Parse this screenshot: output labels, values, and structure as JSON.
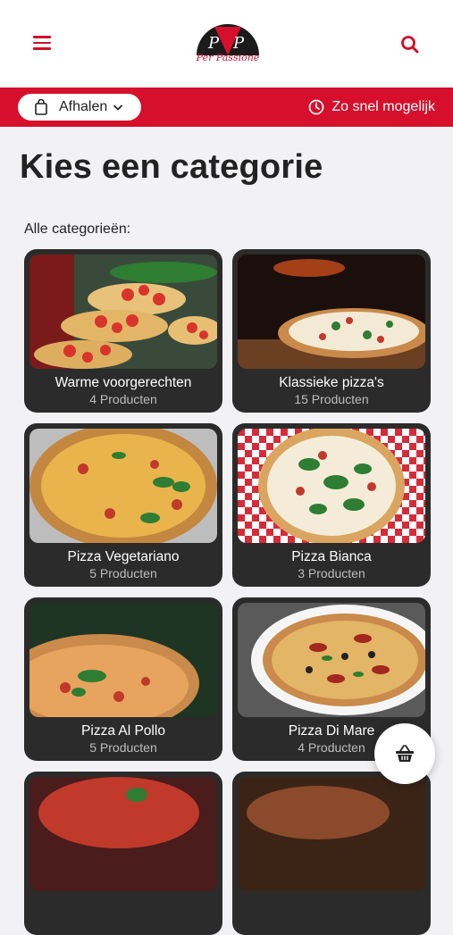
{
  "brand": {
    "logo_text": "Per Passione"
  },
  "header": {
    "menu_icon": "hamburger-menu-icon",
    "search_icon": "search-icon"
  },
  "order_bar": {
    "mode_label": "Afhalen",
    "time_label": "Zo snel mogelijk"
  },
  "page": {
    "title": "Kies een categorie",
    "subtitle": "Alle categorieën:"
  },
  "categories": [
    {
      "name": "Warme voorgerechten",
      "count": "4 Producten"
    },
    {
      "name": "Klassieke pizza's",
      "count": "15 Producten"
    },
    {
      "name": "Pizza Vegetariano",
      "count": "5 Producten"
    },
    {
      "name": "Pizza Bianca",
      "count": "3 Producten"
    },
    {
      "name": "Pizza Al Pollo",
      "count": "5 Producten"
    },
    {
      "name": "Pizza Di Mare",
      "count": "4 Producten"
    },
    {
      "name": "",
      "count": ""
    },
    {
      "name": "",
      "count": ""
    }
  ],
  "colors": {
    "brand_red": "#d6102c",
    "card_bg": "#2b2b2b",
    "page_bg": "#f2f2f4"
  }
}
